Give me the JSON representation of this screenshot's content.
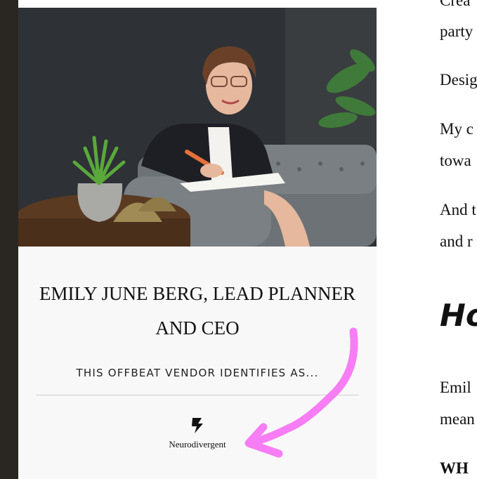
{
  "card": {
    "photo_alt": "Emily June Berg seated on a grey sofa writing in a notebook",
    "vendor_name_line1": "EMILY JUNE BERG, LEAD PLANNER",
    "vendor_name_line2": "AND CEO",
    "identifies_label": "THIS OFFBEAT VENDOR IDENTIFIES AS...",
    "identity_icon": "lightning-bolt-icon",
    "identity_label": "Neurodivergent"
  },
  "article": {
    "lines": [
      "Crea",
      "party",
      "Desig",
      "My c",
      "towa",
      "And t",
      "and r"
    ],
    "heading": "Ho",
    "lines2": [
      "Emil",
      "mean"
    ],
    "bold_line": "WH"
  },
  "colors": {
    "sidebar_dark": "#2a2722",
    "card_bg": "#f8f8f8",
    "annotation_pink": "#f77df5"
  }
}
